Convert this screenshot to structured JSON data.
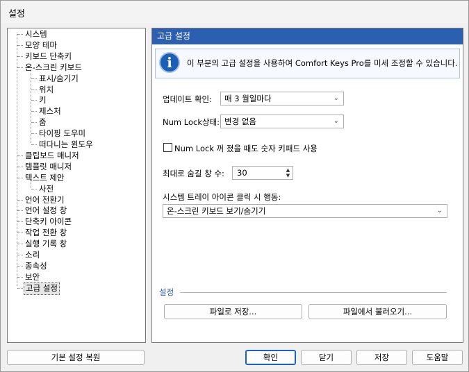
{
  "window": {
    "title": "설정"
  },
  "tree": {
    "items": [
      {
        "label": "시스템"
      },
      {
        "label": "모양 테마"
      },
      {
        "label": "키보드 단축키"
      },
      {
        "label": "온-스크린 키보드"
      },
      {
        "label": "표시/숨기기"
      },
      {
        "label": "위치"
      },
      {
        "label": "키"
      },
      {
        "label": "제스처"
      },
      {
        "label": "줌"
      },
      {
        "label": "타이핑 도우미"
      },
      {
        "label": "떠다니는 윈도우"
      },
      {
        "label": "클립보드 매니저"
      },
      {
        "label": "템플릿 매니저"
      },
      {
        "label": "텍스트 제안"
      },
      {
        "label": "사전"
      },
      {
        "label": "언어 전환기"
      },
      {
        "label": "언어 설정 창"
      },
      {
        "label": "단축키 아이콘"
      },
      {
        "label": "작업 전환 창"
      },
      {
        "label": "실행 기록 창"
      },
      {
        "label": "소리"
      },
      {
        "label": "종속성"
      },
      {
        "label": "보안"
      },
      {
        "label": "고급 설정"
      }
    ],
    "selected": "고급 설정"
  },
  "panel": {
    "header": "고급 설정",
    "info_text": "이 부분의 고급 설정을 사용하여 Comfort Keys Pro를 미세 조정할 수 있습니다.",
    "update_label": "업데이트 확인:",
    "update_value": "매 3 월일마다",
    "numlock_label": "Num Lock상태:",
    "numlock_value": "변경 없음",
    "numlock_checkbox_label": "Num Lock 꺼 졌을 때도 숫자 키패드 사용",
    "numlock_checkbox_checked": false,
    "max_hidden_label": "최대로 숨길 창 수:",
    "max_hidden_value": "30",
    "tray_click_label": "시스템 트레이 아이콘 클릭 시 행동:",
    "tray_click_value": "온-스크린 키보드 보기/숨기기",
    "settings_group_label": "설정",
    "save_to_file": "파일로 저장...",
    "load_from_file": "파일에서 불러오기..."
  },
  "footer": {
    "restore_defaults": "기본 설정 복원",
    "ok": "확인",
    "close": "닫기",
    "save": "저장",
    "help": "도움말"
  },
  "colors": {
    "header_bg": "#2d5fb1",
    "info_icon": "#1c5fb5",
    "group_label": "#2a5aa5"
  },
  "icons": {
    "info": "info-icon",
    "dropdown": "chevron-down-icon",
    "spinner": "up-down-arrows-icon"
  }
}
